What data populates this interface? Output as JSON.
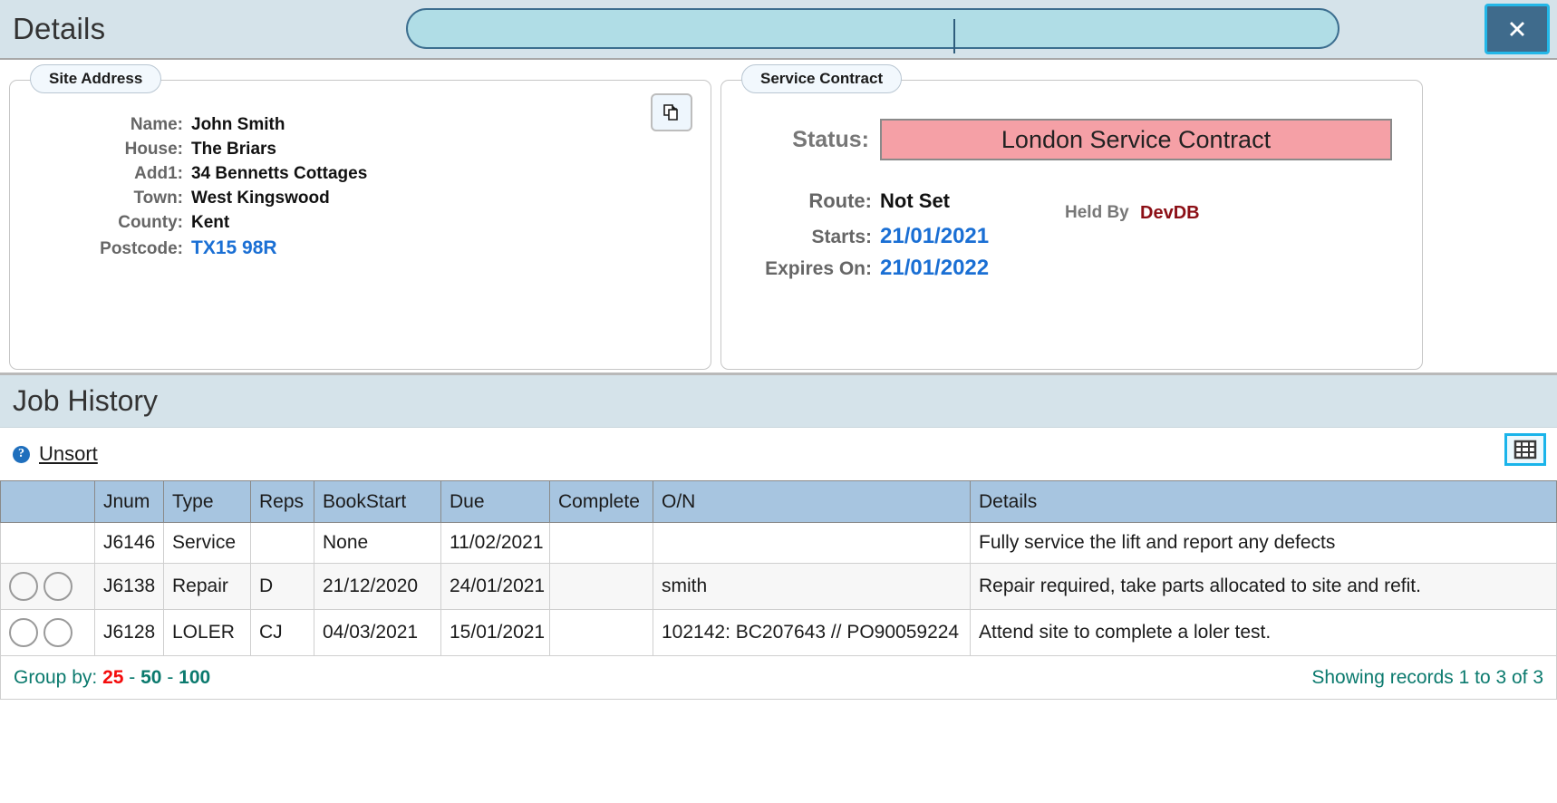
{
  "header": {
    "title": "Details",
    "search_value": "",
    "search_placeholder": "",
    "close_label": "Close"
  },
  "site_address": {
    "legend": "Site Address",
    "copy_icon": "copy-pages-icon",
    "fields": [
      {
        "label": "Name:",
        "value": "John Smith",
        "style": "plain"
      },
      {
        "label": "House:",
        "value": "The Briars",
        "style": "plain"
      },
      {
        "label": "Add1:",
        "value": "34 Bennetts Cottages",
        "style": "plain"
      },
      {
        "label": "Town:",
        "value": "West Kingswood",
        "style": "plain"
      },
      {
        "label": "County:",
        "value": "Kent",
        "style": "plain"
      },
      {
        "label": "Postcode:",
        "value": "TX15 98R",
        "style": "blue"
      }
    ]
  },
  "service_contract": {
    "legend": "Service Contract",
    "status_label": "Status:",
    "status_value": "London Service Contract",
    "status_color": "#f5a0a6",
    "route_label": "Route:",
    "route_value": "Not Set",
    "starts_label": "Starts:",
    "starts_value": "21/01/2021",
    "expires_label": "Expires On:",
    "expires_value": "21/01/2022",
    "held_by_label": "Held By",
    "held_by_value": "DevDB",
    "held_by_color": "#8c0f16"
  },
  "job_history": {
    "title": "Job History",
    "help_icon": "help-icon",
    "unsort_label": "Unsort",
    "grid_icon": "table-grid-icon",
    "columns": [
      "",
      "Jnum",
      "Type",
      "Reps",
      "BookStart",
      "Due",
      "Complete",
      "O/N",
      "Details"
    ],
    "rows": [
      {
        "select": false,
        "jnum": "J6146",
        "type": "Service",
        "reps": "",
        "bookstart": "None",
        "bookstart_style": "none",
        "due": "11/02/2021",
        "complete": "",
        "on": "",
        "details": "Fully service the lift and report any defects"
      },
      {
        "select": true,
        "jnum": "J6138",
        "type": "Repair",
        "reps": "D",
        "bookstart": "21/12/2020",
        "bookstart_style": "plain",
        "due": "24/01/2021",
        "complete": "",
        "on": "smith",
        "details": "Repair required, take parts allocated to site and refit."
      },
      {
        "select": true,
        "jnum": "J6128",
        "type": "LOLER",
        "reps": "CJ",
        "bookstart": "04/03/2021",
        "bookstart_style": "plain",
        "due": "15/01/2021",
        "complete": "",
        "on": "102142: BC207643 // PO90059224",
        "details": "Attend site to complete a loler test."
      }
    ],
    "footer": {
      "group_by_label": "Group by:",
      "group_options": [
        "25",
        "50",
        "100"
      ],
      "group_active": "25",
      "separator": "-",
      "showing": "Showing records 1 to 3 of 3"
    }
  }
}
